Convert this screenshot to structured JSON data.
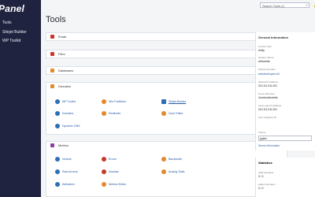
{
  "brand": {
    "logo": "Panel"
  },
  "sidebar": {
    "items": [
      {
        "label": "Tools"
      },
      {
        "label": "Sitejet Builder"
      },
      {
        "label": "WP Toolkit"
      }
    ]
  },
  "header": {
    "title": "Tools",
    "search_placeholder": "Search Tools (/)"
  },
  "panels": [
    {
      "title": "Email"
    },
    {
      "title": "Files"
    },
    {
      "title": "Databases"
    },
    {
      "title": "Domains",
      "items": [
        {
          "label": "WP Toolkit"
        },
        {
          "label": "Site Publisher"
        },
        {
          "label": "Sitejet Builder"
        },
        {
          "label": "Domains"
        },
        {
          "label": "Redirects"
        },
        {
          "label": "Zone Editor"
        },
        {
          "label": "Dynamic DNS"
        }
      ]
    },
    {
      "title": "Metrics",
      "items": [
        {
          "label": "Visitors"
        },
        {
          "label": "Errors"
        },
        {
          "label": "Bandwidth"
        },
        {
          "label": "Raw Access"
        },
        {
          "label": "Awstats"
        },
        {
          "label": "Analog Stats"
        },
        {
          "label": "Webalizer"
        },
        {
          "label": "Metrics Editor"
        }
      ]
    }
  ],
  "general_info": {
    "title": "General Information",
    "current_user_label": "Current User",
    "current_user": "trinity",
    "account_label": "System Owner",
    "account": "webadmin",
    "primary_domain_label": "Primary Domain",
    "primary_domain": "webdevelopers.tld",
    "shared_ip_label": "Shared IP Address",
    "shared_ip": "010.111.011.001",
    "home_dir_label": "Home Directory",
    "home_dir": "/home/webadmin",
    "last_login_label": "Last Login IP Address",
    "last_login": "010.111.011.001",
    "cpanel_version_label": "User Analytics ID",
    "theme_label": "Theme",
    "theme": "jupiter",
    "server_info": "Server Information"
  },
  "statistics": {
    "title": "Statistics",
    "aliases_label": "Alias Domains",
    "aliases": "0 / 0",
    "addon_label": "Addon Domains",
    "addon": "0 / 0"
  }
}
